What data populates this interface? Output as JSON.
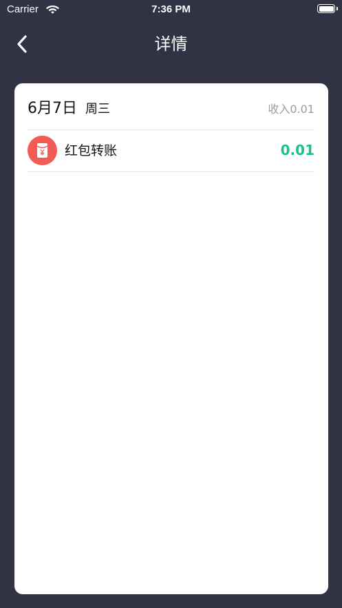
{
  "status_bar": {
    "carrier": "Carrier",
    "time": "7:36 PM"
  },
  "nav": {
    "title": "详情"
  },
  "day_group": {
    "date": "6月7日",
    "weekday": "周三",
    "income_summary": "收入0.01"
  },
  "transactions": [
    {
      "icon": "red-envelope-icon",
      "label": "红包转账",
      "amount": "0.01"
    }
  ],
  "colors": {
    "background": "#313345",
    "card": "#ffffff",
    "amount_positive": "#1dbf8c",
    "icon_red": "#f35b54",
    "muted_text": "#9a9a9a"
  }
}
